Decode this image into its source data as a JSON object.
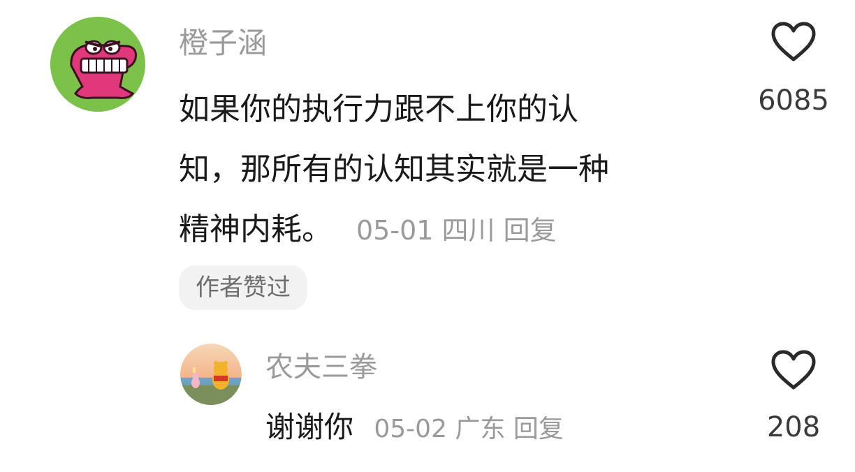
{
  "comments": [
    {
      "username": "橙子涵",
      "text_lines": [
        "如果你的执行力跟不上你的认",
        "知，那所有的认知其实就是一种",
        "精神内耗。"
      ],
      "date": "05-01",
      "location": "四川",
      "reply_label": "回复",
      "like_count": "6085",
      "badge": "作者赞过",
      "avatar_icon": "crocodile-cartoon-avatar",
      "heart_icon": "heart-outline-icon"
    },
    {
      "username": "农夫三拳",
      "text": "谢谢你",
      "date": "05-02",
      "location": "广东",
      "reply_label": "回复",
      "like_count": "208",
      "avatar_icon": "winnie-the-pooh-sunset-avatar",
      "heart_icon": "heart-outline-icon"
    }
  ],
  "colors": {
    "username": "#9a9a9a",
    "text": "#1a1a1a",
    "meta": "#9a9a9a",
    "badge_bg": "#f2f2f2",
    "avatar1_bg": "#7cc24a",
    "avatar1_croc": "#e0387a"
  }
}
